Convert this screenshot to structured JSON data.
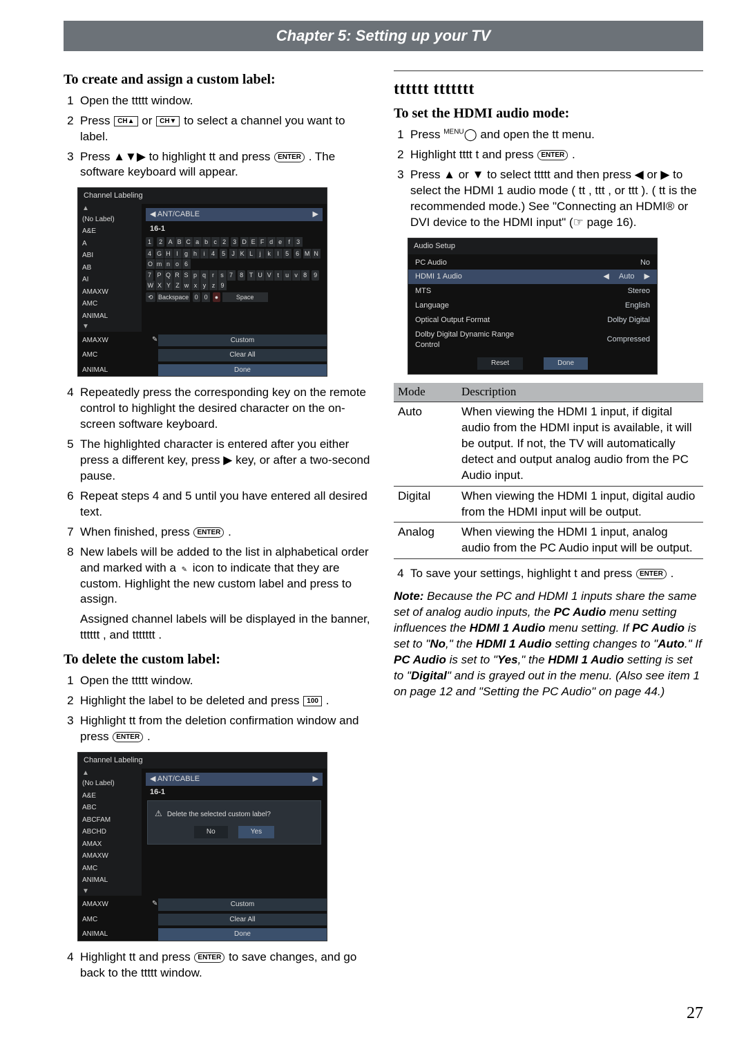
{
  "header": "Chapter 5: Setting up your TV",
  "page_number": "27",
  "left": {
    "h1": "To create and assign a custom label:",
    "step1": "Open the  ttttt  window.",
    "step2a": "Press ",
    "step2b": " or ",
    "step2c": " to select a channel you want to label.",
    "step3a": "Press ▲▼▶ to highlight  tt  and press ",
    "step3b": ". The software keyboard will appear.",
    "step4": "Repeatedly press the corresponding key on the remote control to highlight the desired character on the on-screen software keyboard.",
    "step5a": "The highlighted character is entered after you either press a different key, press ",
    "step5b": " key, or after a two-second pause.",
    "step6": "Repeat steps 4 and 5 until you have entered all desired text.",
    "step7a": "When finished, press ",
    "step7b": ".",
    "step8a": "New labels will be added to the list in alphabetical order and marked with a ",
    "step8b": " icon to indicate that they are custom. Highlight the new custom label and press to assign.",
    "step8c": "Assigned channel labels will be displayed in the banner,   tttttt  , and   ttttttt  .",
    "h2": "To delete the custom label:",
    "del1": "Open the  ttttt  window.",
    "del2a": "Highlight the label to be deleted and press ",
    "del2b": ".",
    "del3a": "Highlight  tt  from the deletion confirmation window and press ",
    "del3b": ".",
    "del4a": "Highlight  tt  and press ",
    "del4b": " to save changes, and go back to the  ttttt  window."
  },
  "osd1": {
    "title": "Channel Labeling",
    "list": [
      "(No Label)",
      "A&E",
      "A",
      "ABI",
      "AB",
      "AI",
      "AMAXW",
      "AMC",
      "ANIMAL"
    ],
    "antcable": "ANT/CABLE",
    "channel": "16-1",
    "kb": {
      "r1": [
        [
          "1",
          ""
        ],
        [
          "2",
          "A B C a b c 2"
        ],
        [
          "3",
          "D E F d e f 3"
        ]
      ],
      "r2": [
        [
          "4",
          "G H I g h i 4"
        ],
        [
          "5",
          "J K L j k l 5"
        ],
        [
          "6",
          "M N O m n o 6"
        ]
      ],
      "r3": [
        [
          "7",
          "P Q R S p q r s 7"
        ],
        [
          "8",
          "T U V t u v 8"
        ],
        [
          "9",
          "W X Y Z w x y z 9"
        ]
      ],
      "backspace": "Backspace",
      "zero": "0",
      "space": "Space"
    },
    "btns": {
      "custom": "Custom",
      "clear": "Clear All",
      "done": "Done"
    }
  },
  "osd2": {
    "title": "Channel Labeling",
    "list": [
      "(No Label)",
      "A&E",
      "ABC",
      "ABCFAM",
      "ABCHD",
      "AMAX",
      "AMAXW",
      "AMC",
      "ANIMAL"
    ],
    "antcable": "ANT/CABLE",
    "channel": "16-1",
    "question": "Delete the selected custom label?",
    "no": "No",
    "yes": "Yes",
    "btns": {
      "custom": "Custom",
      "clear": "Clear All",
      "done": "Done"
    }
  },
  "right": {
    "big_h": "tttttt  ttttttt",
    "h1": "To set the HDMI audio mode:",
    "step1a": "Press ",
    "step1b": " and open the  tt  menu.",
    "step2a": "Highlight  tttt t  and press ",
    "step2b": ".",
    "step3a": "Press ▲ or ▼ to select  ttttt  and then press ◀ or ▶ to select the HDMI 1 audio mode ( tt ,  ttt , or  ttt ). ( tt  is the recommended mode.) See \"Connecting an HDMI® or DVI device to the HDMI input\" (☞ page 16).",
    "step4a": "To save your settings, highlight  t  and press ",
    "step4b": "."
  },
  "osd3": {
    "title": "Audio Setup",
    "rows": [
      {
        "label": "PC Audio",
        "value": "No"
      },
      {
        "label": "HDMI 1 Audio",
        "value": "Auto",
        "selected": true
      },
      {
        "label": "MTS",
        "value": "Stereo"
      },
      {
        "label": "Language",
        "value": "English"
      },
      {
        "label": "Optical Output Format",
        "value": "Dolby Digital"
      },
      {
        "label": "Dolby Digital Dynamic Range Control",
        "value": "Compressed",
        "twoLine": true
      }
    ],
    "reset": "Reset",
    "done": "Done"
  },
  "modes_header": {
    "mode": "Mode",
    "desc": "Description"
  },
  "modes": [
    {
      "mode": "Auto",
      "desc": "When viewing the HDMI 1 input, if digital audio from the HDMI input is available, it will be output. If not, the TV will automatically detect and output analog audio from the PC Audio input."
    },
    {
      "mode": "Digital",
      "desc": "When viewing the HDMI 1 input, digital audio from the HDMI input will be output."
    },
    {
      "mode": "Analog",
      "desc": "When viewing the HDMI 1 input, analog audio from the PC Audio input will be output."
    }
  ],
  "note": "Note: Because the PC and HDMI 1 inputs share the same set of analog audio inputs, the PC Audio menu setting influences the HDMI 1 Audio menu setting. If PC Audio is set to \"No,\" the HDMI 1 Audio setting changes to \"Auto.\" If PC Audio is set to \"Yes,\" the HDMI 1 Audio setting is set to \"Digital\" and is grayed out in the menu. (Also see item 1 on page 12 and \"Setting the PC Audio\" on page 44.)",
  "keys": {
    "ch_up": "CH▲",
    "ch_down": "CH▼",
    "enter": "ENTER",
    "hundred": "100",
    "menu": "MENU",
    "arrow_right_big": "▶"
  }
}
